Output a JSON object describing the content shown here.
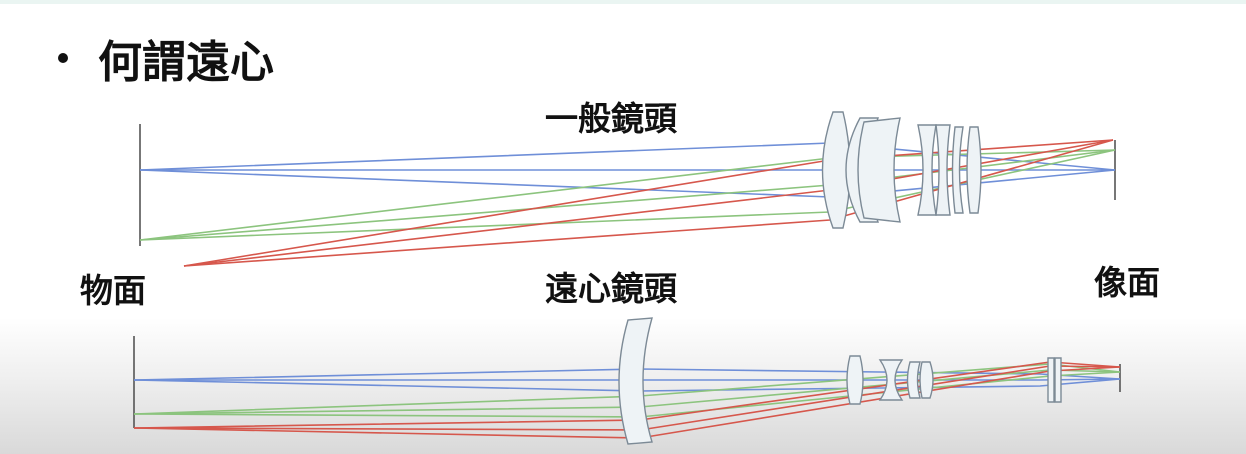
{
  "slide": {
    "title": "何謂遠心",
    "top_label": "一般鏡頭",
    "bottom_label": "遠心鏡頭",
    "object_plane_label": "物面",
    "image_plane_label": "像面"
  },
  "colors": {
    "ray_blue": "#6f8fd8",
    "ray_green": "#8cc47e",
    "ray_red": "#d6574c",
    "lens_outline": "#7c8a96",
    "lens_fill": "#eef3f6"
  }
}
